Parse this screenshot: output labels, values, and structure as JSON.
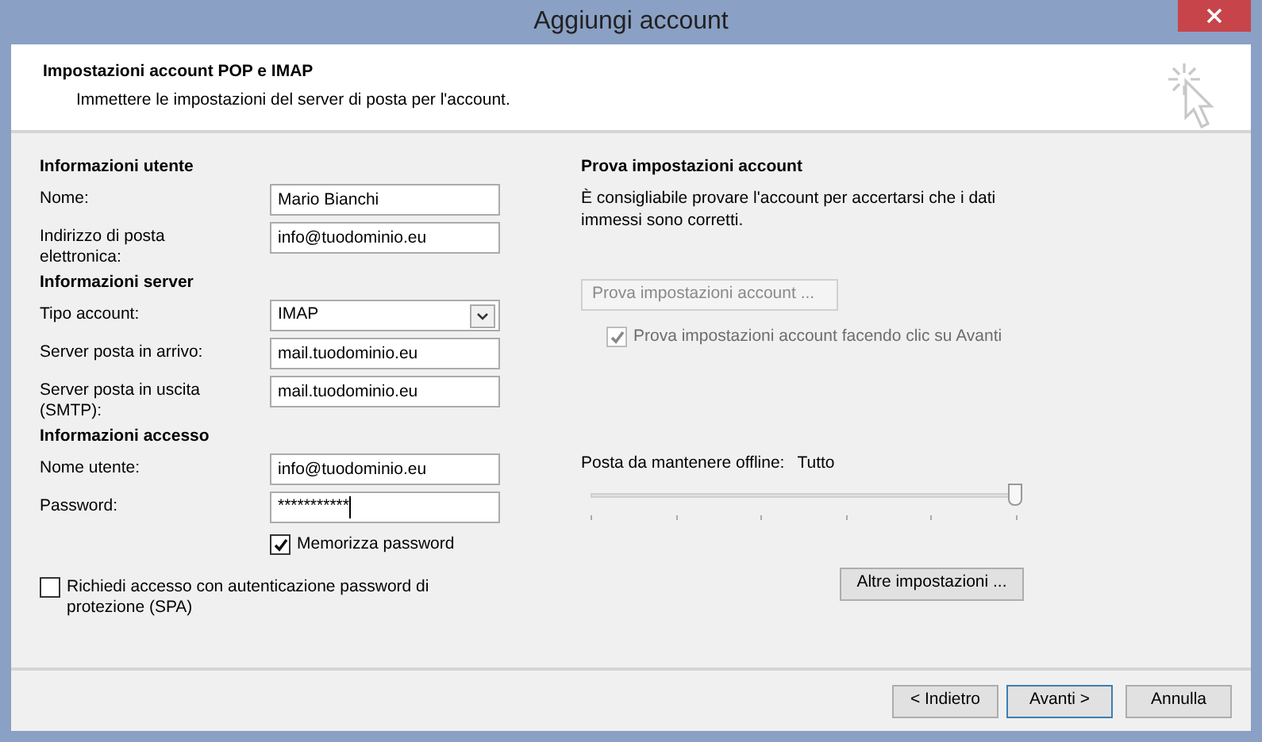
{
  "window": {
    "title": "Aggiungi account"
  },
  "header": {
    "title": "Impostazioni account POP e IMAP",
    "subtitle": "Immettere le impostazioni del server di posta per l'account."
  },
  "left_sections": [
    {
      "heading": "Informazioni utente",
      "fields": [
        {
          "label": "Nome:",
          "kind": "text",
          "value": "Mario Bianchi"
        },
        {
          "label": "Indirizzo di posta elettronica:",
          "kind": "text",
          "value": "info@tuodominio.eu"
        }
      ]
    },
    {
      "heading": "Informazioni server",
      "fields": [
        {
          "label": "Tipo account:",
          "kind": "dropdown",
          "value": "IMAP"
        },
        {
          "label": "Server posta in arrivo:",
          "kind": "text",
          "value": "mail.tuodominio.eu"
        },
        {
          "label": "Server posta in uscita (SMTP):",
          "kind": "text",
          "value": "mail.tuodominio.eu"
        }
      ]
    },
    {
      "heading": "Informazioni accesso",
      "fields": [
        {
          "label": "Nome utente:",
          "kind": "text",
          "value": "info@tuodominio.eu"
        },
        {
          "label": "Password:",
          "kind": "password",
          "value": "***********"
        }
      ]
    }
  ],
  "remember_password": {
    "label": "Memorizza password",
    "checked": true
  },
  "spa": {
    "label": "Richiedi accesso con autenticazione password di protezione (SPA)",
    "checked": false
  },
  "test": {
    "heading": "Prova impostazioni account",
    "description": "È consigliabile provare l'account per accertarsi che i dati immessi sono corretti.",
    "button": "Prova impostazioni account ...",
    "button_disabled": true,
    "auto_test": {
      "label": "Prova impostazioni account facendo clic su Avanti",
      "checked": true,
      "disabled": true
    }
  },
  "offline": {
    "label": "Posta da mantenere offline:",
    "reading": "Tutto",
    "level": 1.0
  },
  "more_settings": "Altre impostazioni ...",
  "footer_buttons": [
    {
      "label": "< Indietro",
      "selected": false
    },
    {
      "label": "Avanti >",
      "selected": true
    },
    {
      "label": "Annulla",
      "selected": false
    }
  ]
}
